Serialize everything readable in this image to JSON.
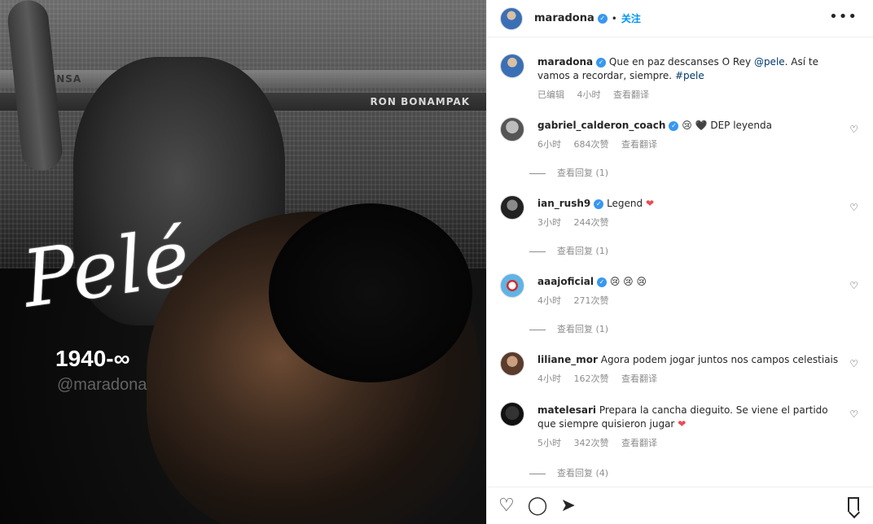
{
  "post_image": {
    "signature_text": "Pelé",
    "years_text": "1940-∞",
    "watermark_text": "@maradona",
    "banner_texts": [
      "PRENSA",
      "RON BONAMPAK"
    ]
  },
  "header": {
    "username": "maradona",
    "separator": "•",
    "follow_label": "关注",
    "more_icon": "more-horizontal-icon"
  },
  "caption": {
    "username": "maradona",
    "text": "Que en paz descanses O Rey ",
    "mention": "@pele",
    "text2": ". Así te vamos a recordar, siempre. ",
    "hashtag": "#pele",
    "meta_edited": "已编辑",
    "meta_time": "4小时",
    "meta_translate": "查看翻译"
  },
  "comments": [
    {
      "username": "gabriel_calderon_coach",
      "text": "😢 🖤 DEP leyenda ",
      "time": "6小时",
      "likes": "684次赞",
      "translate": "查看翻译",
      "replies": "查看回复 (1)"
    },
    {
      "username": "ian_rush9",
      "text": "Legend ",
      "heart": "❤",
      "time": "3小时",
      "likes": "244次赞",
      "replies": "查看回复 (1)"
    },
    {
      "username": "aaajoficial",
      "text": "😢 😢 😢",
      "time": "4小时",
      "likes": "271次赞",
      "replies": "查看回复 (1)"
    },
    {
      "username": "liliane_mor",
      "text": "Agora podem jogar juntos nos campos celestiais",
      "time": "4小时",
      "likes": "162次赞",
      "translate": "查看翻译"
    },
    {
      "username": "matelesari",
      "text": "Prepara la cancha dieguito. Se viene el partido que siempre quisieron jugar ",
      "heart": "❤",
      "time": "5小时",
      "likes": "342次赞",
      "translate": "查看翻译",
      "replies": "查看回复 (4)"
    }
  ],
  "actions": {
    "like_icon": "heart-icon",
    "comment_icon": "comment-icon",
    "share_icon": "send-icon",
    "save_icon": "bookmark-icon"
  },
  "colors": {
    "accent": "#0095f6",
    "verified": "#3897f0",
    "heart_red": "#ed4956"
  }
}
